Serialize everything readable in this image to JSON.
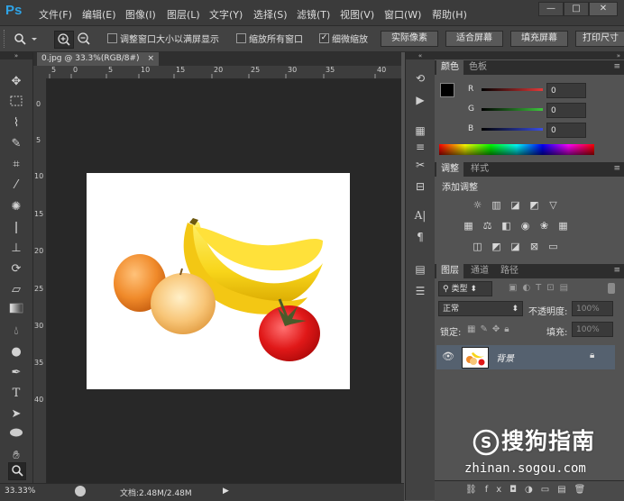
{
  "app": {
    "logo": "Ps"
  },
  "menu": [
    "文件(F)",
    "编辑(E)",
    "图像(I)",
    "图层(L)",
    "文字(Y)",
    "选择(S)",
    "滤镜(T)",
    "视图(V)",
    "窗口(W)",
    "帮助(H)"
  ],
  "window_controls": {
    "minimize": "—",
    "restore": "□",
    "close": "✕"
  },
  "options_bar": {
    "checkbox_resize_window": {
      "label": "调整窗口大小以满屏显示",
      "checked": false
    },
    "checkbox_zoom_all": {
      "label": "缩放所有窗口",
      "checked": false
    },
    "checkbox_scrubby_zoom": {
      "label": "细微缩放",
      "checked": true
    },
    "btn_actual_pixels": "实际像素",
    "btn_fit_screen": "适合屏幕",
    "btn_fill_screen": "填充屏幕",
    "btn_print_size": "打印尺寸"
  },
  "document": {
    "tab_title": "0.jpg @ 33.3%(RGB/8#)",
    "tab_close": "×",
    "ruler_h_labels": [
      "5",
      "0",
      "5",
      "10",
      "15",
      "20",
      "25",
      "30",
      "35",
      "40"
    ],
    "ruler_v_labels": [
      "0",
      "5",
      "10",
      "15",
      "20",
      "25",
      "30",
      "35",
      "40"
    ]
  },
  "status_bar": {
    "zoom": "33.33%",
    "doc_size": "文档:2.48M/2.48M",
    "arrow": "▶"
  },
  "color_panel": {
    "tabs": [
      "颜色",
      "色板"
    ],
    "channels": [
      {
        "label": "R",
        "value": "0",
        "color": "#e23a3a"
      },
      {
        "label": "G",
        "value": "0",
        "color": "#3ec43e"
      },
      {
        "label": "B",
        "value": "0",
        "color": "#3a4ee2"
      }
    ]
  },
  "adjustments_panel": {
    "tabs": [
      "调整",
      "样式"
    ],
    "heading": "添加调整"
  },
  "layers_panel": {
    "tabs": [
      "图层",
      "通道",
      "路径"
    ],
    "filter_kind": "类型",
    "blend_mode": "正常",
    "opacity_label": "不透明度:",
    "opacity_value": "100%",
    "lock_label": "锁定:",
    "fill_label": "填充:",
    "fill_value": "100%",
    "layer_name": "背景"
  },
  "watermark": {
    "brand": "搜狗指南",
    "url": "zhinan.sogou.com"
  },
  "colors": {
    "accent_blue": "#2fa4e7",
    "selected_layer": "#55616f"
  }
}
